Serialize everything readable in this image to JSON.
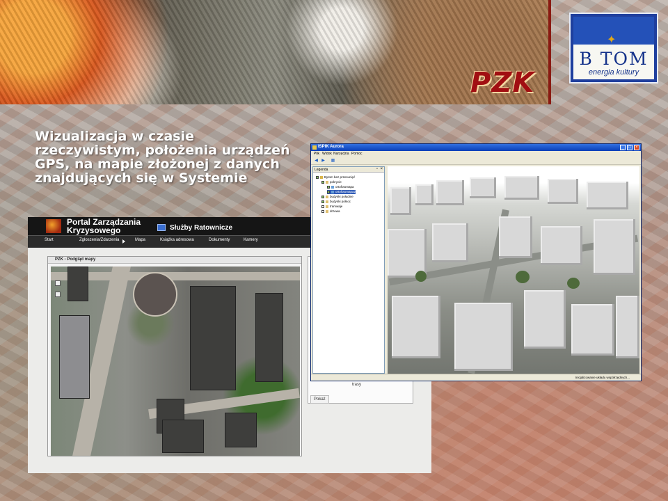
{
  "banner": {
    "brand": "PZK"
  },
  "logo": {
    "name": "B TOM",
    "tagline": "energia kultury"
  },
  "headline": "Wizualizacja w czasie rzeczywistym, położenia urządzeń GPS, na mapie złożonej z danych znajdujących się w Systemie",
  "portal": {
    "title": "Portal Zarządzania Kryzysowego",
    "service": "Służby Ratownicze",
    "nav": [
      "Start",
      "Zgłoszenia/Zdarzenia",
      "Mapa",
      "Książka adresowa",
      "Dokumenty",
      "Kamery"
    ],
    "map_window_title": "PZK - Podgląd mapy",
    "right_list_item": "trasy",
    "show_button": "Pokaż"
  },
  "ispik": {
    "title": "ISPIK Aurora",
    "menu": [
      "Plik",
      "Widok",
      "Narzędzia",
      "Pomoc"
    ],
    "legend_title": "Legenda",
    "tree": [
      {
        "label": "Bytom bez przesunięć",
        "level": 0,
        "checked": true,
        "selected": false
      },
      {
        "label": "pokrycie",
        "level": 1,
        "checked": true,
        "selected": false
      },
      {
        "label": "ortofotomapa",
        "level": 2,
        "checked": true,
        "selected": false
      },
      {
        "label": "ortofotomapa2",
        "level": 2,
        "checked": true,
        "selected": true
      },
      {
        "label": "budynki południe",
        "level": 1,
        "checked": true,
        "selected": false
      },
      {
        "label": "budynki północ",
        "level": 1,
        "checked": true,
        "selected": false
      },
      {
        "label": "tramwaje",
        "level": 1,
        "checked": false,
        "selected": false
      },
      {
        "label": "drzewa",
        "level": 1,
        "checked": false,
        "selected": false
      }
    ],
    "status": "Inicjalizowanie układu współrzędnych..."
  },
  "colors": {
    "brand_red": "#a10f12",
    "logo_blue": "#1f3f9e",
    "xp_title_blue": "#0a3fb8"
  }
}
